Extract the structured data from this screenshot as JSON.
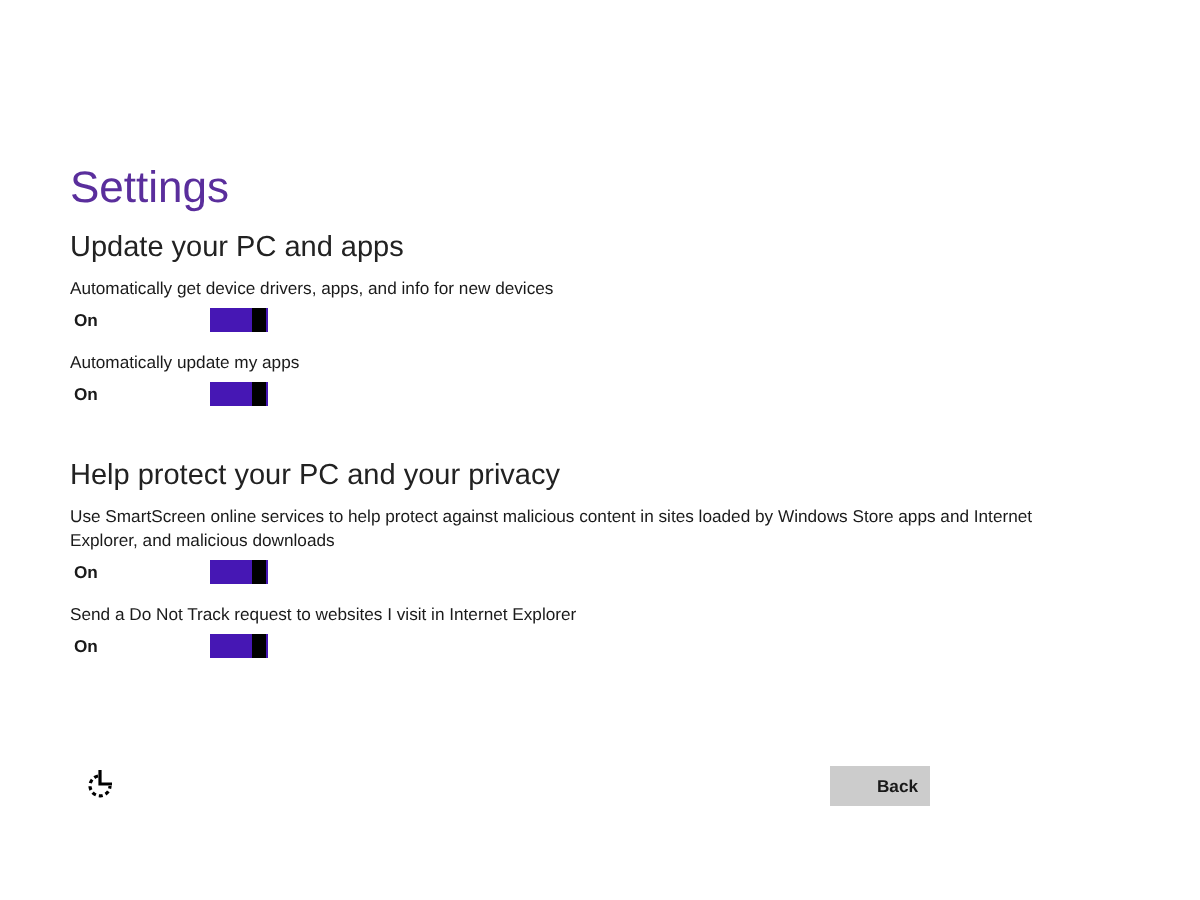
{
  "title": "Settings",
  "sections": [
    {
      "heading": "Update your PC and apps",
      "settings": [
        {
          "description": "Automatically get device drivers, apps, and info for new devices",
          "state_label": "On",
          "on": true
        },
        {
          "description": "Automatically update my apps",
          "state_label": "On",
          "on": true
        }
      ]
    },
    {
      "heading": "Help protect your PC and your privacy",
      "settings": [
        {
          "description": "Use SmartScreen online services to help protect against malicious content in sites loaded by Windows Store apps and Internet Explorer, and malicious downloads",
          "state_label": "On",
          "on": true
        },
        {
          "description": "Send a Do Not Track request to websites I visit in Internet Explorer",
          "state_label": "On",
          "on": true
        }
      ]
    }
  ],
  "buttons": [
    "Back"
  ]
}
